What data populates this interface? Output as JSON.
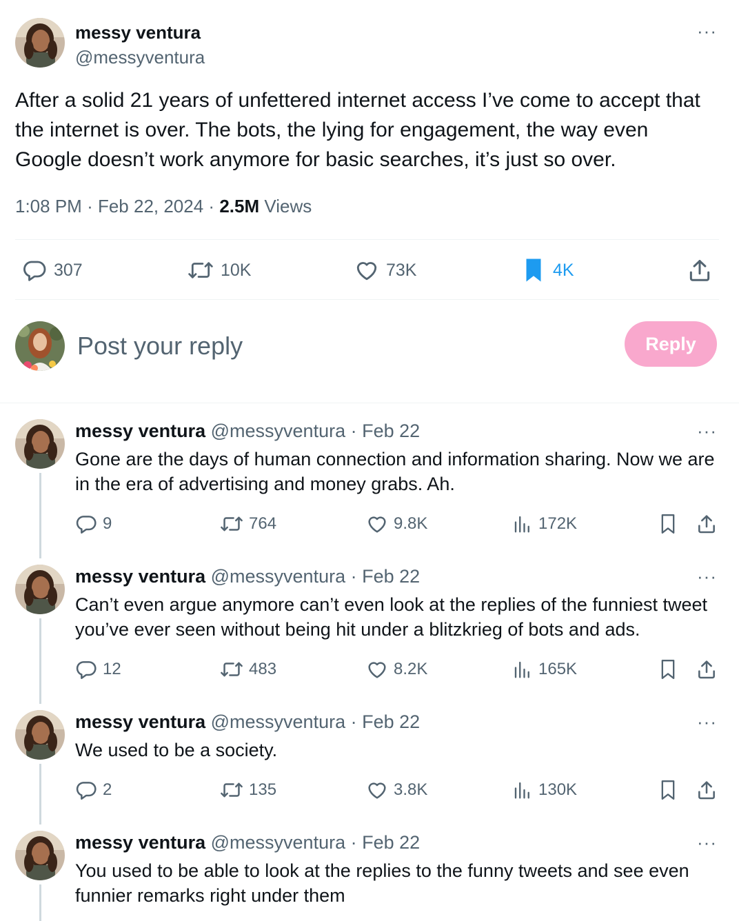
{
  "main_post": {
    "author_name": "messy ventura",
    "author_handle": "@messyventura",
    "text": "After a solid 21 years of unfettered internet access I’ve come to accept that the internet is over. The bots, the lying for engagement, the way even Google doesn’t work anymore for basic searches, it’s just so over.",
    "time": "1:08 PM",
    "date": "Feb 22, 2024",
    "views_count": "2.5M",
    "views_label": "Views",
    "stats": {
      "replies": "307",
      "reposts": "10K",
      "likes": "73K",
      "bookmarks": "4K"
    },
    "more_label": "···"
  },
  "compose": {
    "placeholder": "Post your reply",
    "button_label": "Reply"
  },
  "colors": {
    "accent_blue": "#1d9bf0",
    "reply_button_pink": "#f9a8cd",
    "secondary_text": "#536471"
  },
  "replies": [
    {
      "name": "messy ventura",
      "handle": "@messyventura",
      "separator": "·",
      "date": "Feb 22",
      "text": "Gone are the days of human connection and information sharing. Now we are in the era of advertising and money grabs. Ah.",
      "replies": "9",
      "reposts": "764",
      "likes": "9.8K",
      "views": "172K"
    },
    {
      "name": "messy ventura",
      "handle": "@messyventura",
      "separator": "·",
      "date": "Feb 22",
      "text": "Can’t even argue anymore can’t even look at the replies of the funniest tweet you’ve ever seen without being hit under a blitzkrieg of bots and ads.",
      "replies": "12",
      "reposts": "483",
      "likes": "8.2K",
      "views": "165K"
    },
    {
      "name": "messy ventura",
      "handle": "@messyventura",
      "separator": "·",
      "date": "Feb 22",
      "text": "We used to be a society.",
      "replies": "2",
      "reposts": "135",
      "likes": "3.8K",
      "views": "130K"
    },
    {
      "name": "messy ventura",
      "handle": "@messyventura",
      "separator": "·",
      "date": "Feb 22",
      "text": "You used to be able to look at the replies to the funny tweets and see even funnier remarks right under them"
    }
  ],
  "icons": {
    "reply": "speech-bubble-icon",
    "repost": "repost-arrows-icon",
    "like": "heart-icon",
    "bookmark": "bookmark-icon",
    "share": "share-upload-icon",
    "views": "bar-chart-icon",
    "more": "more-dots-icon"
  }
}
